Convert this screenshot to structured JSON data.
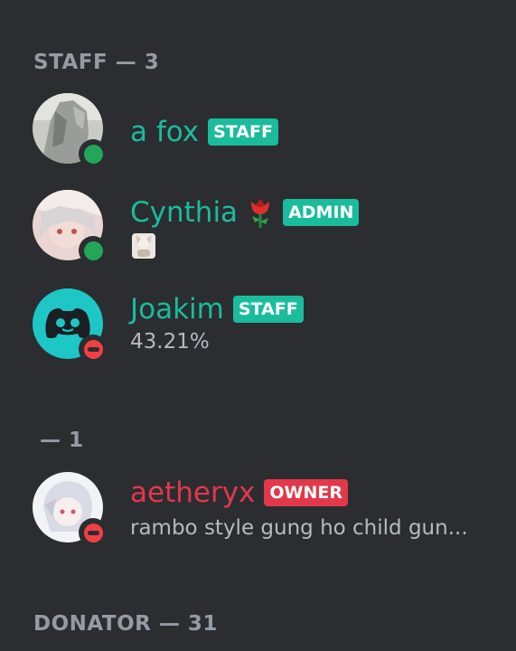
{
  "sections": {
    "staff_header": "STAFF — 3",
    "unnamed_header": "— 1",
    "donator_header": "DONATOR — 31"
  },
  "members": {
    "afox": {
      "name": "a fox",
      "badge": "STAFF",
      "status": "online",
      "name_color": "#1abc9c",
      "badge_color": "#1abc9c"
    },
    "cynthia": {
      "name": "Cynthia",
      "badge": "ADMIN",
      "status": "online",
      "emoji": "rose-emoji",
      "name_color": "#1abc9c",
      "badge_color": "#1abc9c"
    },
    "joakim": {
      "name": "Joakim",
      "badge": "STAFF",
      "status": "dnd",
      "activity": "43.21%",
      "name_color": "#1abc9c",
      "badge_color": "#1abc9c"
    },
    "aetheryx": {
      "name": "aetheryx",
      "badge": "OWNER",
      "status": "dnd",
      "activity": "rambo style gung ho child gun...",
      "name_color": "#e2384a",
      "badge_color": "#e2384a"
    }
  },
  "colors": {
    "background": "#2b2d31",
    "header_text": "#949ba4",
    "online": "#23a55a",
    "dnd": "#f23f43",
    "staff_teal": "#1abc9c",
    "owner_red": "#e2384a"
  }
}
